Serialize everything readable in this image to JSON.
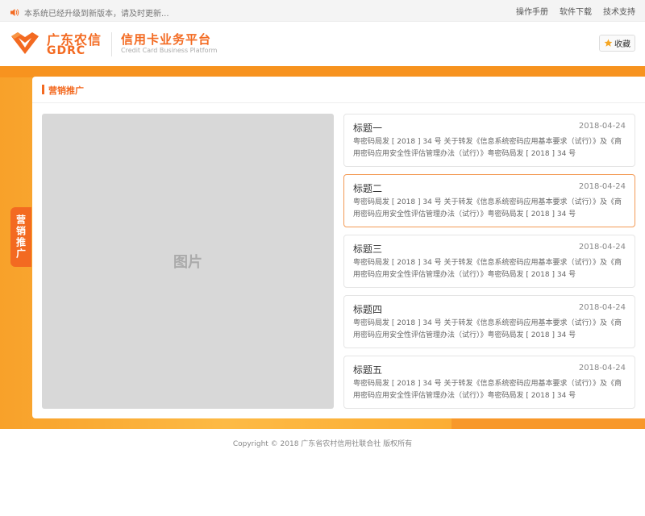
{
  "topbar": {
    "notice_icon": "speaker-icon",
    "notice": "本系统已经升级到新版本，请及时更新...",
    "links": [
      "操作手册",
      "软件下载",
      "技术支持"
    ]
  },
  "header": {
    "logo_cn": "广东农信",
    "logo_en": "GDRC",
    "platform_cn": "信用卡业务平台",
    "platform_en": "Credit Card Business Platform",
    "favorite_icon": "star-icon",
    "favorite_label": "收藏"
  },
  "side_tab": {
    "label": "营销推广"
  },
  "panel": {
    "title": "营销推广",
    "image_label": "图片",
    "items": [
      {
        "title": "标题一",
        "date": "2018-04-24",
        "desc": "粤密码局发 [ 2018 ] 34 号  关于转发《信息系统密码应用基本要求（试行）》及《商用密码应用安全性评估管理办法（试行）》粤密码局发 [ 2018 ] 34 号",
        "active": false
      },
      {
        "title": "标题二",
        "date": "2018-04-24",
        "desc": "粤密码局发 [ 2018 ] 34 号  关于转发《信息系统密码应用基本要求（试行）》及《商用密码应用安全性评估管理办法（试行）》粤密码局发 [ 2018 ] 34 号",
        "active": true
      },
      {
        "title": "标题三",
        "date": "2018-04-24",
        "desc": "粤密码局发 [ 2018 ] 34 号  关于转发《信息系统密码应用基本要求（试行）》及《商用密码应用安全性评估管理办法（试行）》粤密码局发 [ 2018 ] 34 号",
        "active": false
      },
      {
        "title": "标题四",
        "date": "2018-04-24",
        "desc": "粤密码局发 [ 2018 ] 34 号  关于转发《信息系统密码应用基本要求（试行）》及《商用密码应用安全性评估管理办法（试行）》粤密码局发 [ 2018 ] 34 号",
        "active": false
      },
      {
        "title": "标题五",
        "date": "2018-04-24",
        "desc": "粤密码局发 [ 2018 ] 34 号  关于转发《信息系统密码应用基本要求（试行）》及《商用密码应用安全性评估管理办法（试行）》粤密码局发 [ 2018 ] 34 号",
        "active": false
      }
    ]
  },
  "footer": {
    "copyright": "Copyright © 2018  广东省农村信用社联合社  版权所有"
  },
  "colors": {
    "brand": "#f36a21",
    "band": "#fcad34",
    "image_placeholder": "#d8d8d8"
  }
}
